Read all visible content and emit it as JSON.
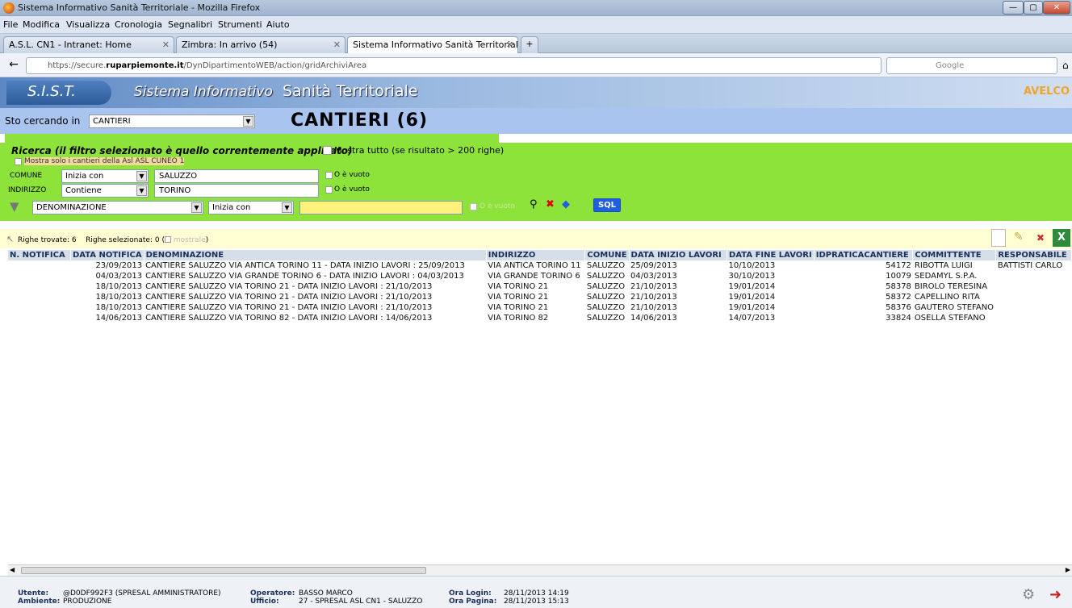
{
  "window": {
    "title": "Sistema Informativo Sanità Territoriale - Mozilla Firefox",
    "min": "—",
    "max": "▢",
    "close": "✕"
  },
  "menu": [
    "File",
    "Modifica",
    "Visualizza",
    "Cronologia",
    "Segnalibri",
    "Strumenti",
    "Aiuto"
  ],
  "tabs": [
    {
      "label": "A.S.L. CN1 - Intranet: Home"
    },
    {
      "label": "Zimbra: In arrivo (54)"
    },
    {
      "label": "Sistema Informativo Sanità Territoriale"
    }
  ],
  "new_tab": "+",
  "nav": {
    "url_prefix": "https://secure.",
    "url_domain": "ruparpiemonte.it",
    "url_path": "/DynDipartimentoWEB/action/gridArchiviArea",
    "search_placeholder": "Google",
    "back": "←"
  },
  "app": {
    "logo": "S.I.S.T.",
    "title1": "Sistema Informativo",
    "title2": "Sanità Territoriale",
    "brand": "AVELCO"
  },
  "search_in": {
    "label": "Sto cercando in",
    "value": "CANTIERI",
    "heading": "CANTIERI (6)"
  },
  "filter": {
    "header": "Ricerca (il filtro selezionato è quello correntemente applicato)",
    "show_all": "Mostra tutto (se risultato > 200 righe)",
    "only_asl": "Mostra solo i cantieri della Asl ASL CUNEO 1",
    "rows": [
      {
        "field": "COMUNE",
        "operator": "Inizia con",
        "value": "SALUZZO",
        "empty": "O è vuoto"
      },
      {
        "field": "INDIRIZZO",
        "operator": "Contiene",
        "value": "TORINO",
        "empty": "O è vuoto"
      }
    ],
    "extra": {
      "field": "DENOMINAZIONE",
      "operator": "Inizia con",
      "value": "",
      "empty": "O è vuoto"
    },
    "sql": "SQL"
  },
  "results": {
    "found_label": "Righe trovate:",
    "found": "6",
    "selected_label": "Righe selezionate:",
    "selected": "0",
    "show_label": "mostrale"
  },
  "grid": {
    "columns": [
      "N. NOTIFICA",
      "DATA NOTIFICA",
      "DENOMINAZIONE",
      "INDIRIZZO",
      "COMUNE",
      "DATA INIZIO LAVORI",
      "DATA FINE LAVORI",
      "IDPRATICACANTIERE",
      "COMMITTENTE",
      "RESPONSABILE"
    ],
    "rows": [
      [
        "",
        "23/09/2013",
        "CANTIERE SALUZZO VIA ANTICA TORINO 11  - DATA INIZIO LAVORI : 25/09/2013",
        "VIA ANTICA TORINO 11",
        "SALUZZO",
        "25/09/2013",
        "10/10/2013",
        "54172",
        "RIBOTTA LUIGI",
        "BATTISTI CARLO"
      ],
      [
        "",
        "04/03/2013",
        "CANTIERE SALUZZO VIA GRANDE TORINO 6  - DATA INIZIO LAVORI : 04/03/2013",
        "VIA GRANDE TORINO 6",
        "SALUZZO",
        "04/03/2013",
        "30/10/2013",
        "10079",
        "SEDAMYL S.P.A.",
        ""
      ],
      [
        "",
        "18/10/2013",
        "CANTIERE SALUZZO VIA TORINO 21  - DATA INIZIO LAVORI : 21/10/2013",
        "VIA TORINO 21",
        "SALUZZO",
        "21/10/2013",
        "19/01/2014",
        "58378",
        "BIROLO TERESINA",
        ""
      ],
      [
        "",
        "18/10/2013",
        "CANTIERE SALUZZO VIA TORINO 21  - DATA INIZIO LAVORI : 21/10/2013",
        "VIA TORINO 21",
        "SALUZZO",
        "21/10/2013",
        "19/01/2014",
        "58372",
        "CAPELLINO RITA",
        ""
      ],
      [
        "",
        "18/10/2013",
        "CANTIERE SALUZZO VIA TORINO 21  - DATA INIZIO LAVORI : 21/10/2013",
        "VIA TORINO 21",
        "SALUZZO",
        "21/10/2013",
        "19/01/2014",
        "58376",
        "GAUTERO STEFANO",
        ""
      ],
      [
        "",
        "14/06/2013",
        "CANTIERE SALUZZO VIA TORINO 82  - DATA INIZIO LAVORI : 14/06/2013",
        "VIA TORINO 82",
        "SALUZZO",
        "14/06/2013",
        "14/07/2013",
        "33824",
        "OSELLA STEFANO",
        ""
      ]
    ]
  },
  "footer": {
    "user_label": "Utente:",
    "user": "@D0DF992F3 (SPRESAL AMMINISTRATORE)",
    "env_label": "Ambiente:",
    "env": "PRODUZIONE",
    "op_label": "Operatore:",
    "op": "BASSO MARCO",
    "office_label": "Ufficio:",
    "office": "27 - SPRESAL ASL CN1 - SALUZZO",
    "login_label": "Ora Login:",
    "login": "28/11/2013 14:19",
    "page_label": "Ora Pagina:",
    "page": "28/11/2013 15:13"
  },
  "colors": {
    "accent": "#8ee33a",
    "header": "#5d88c3",
    "searchrow": "#a9c5ef",
    "results": "#fffdd2"
  }
}
